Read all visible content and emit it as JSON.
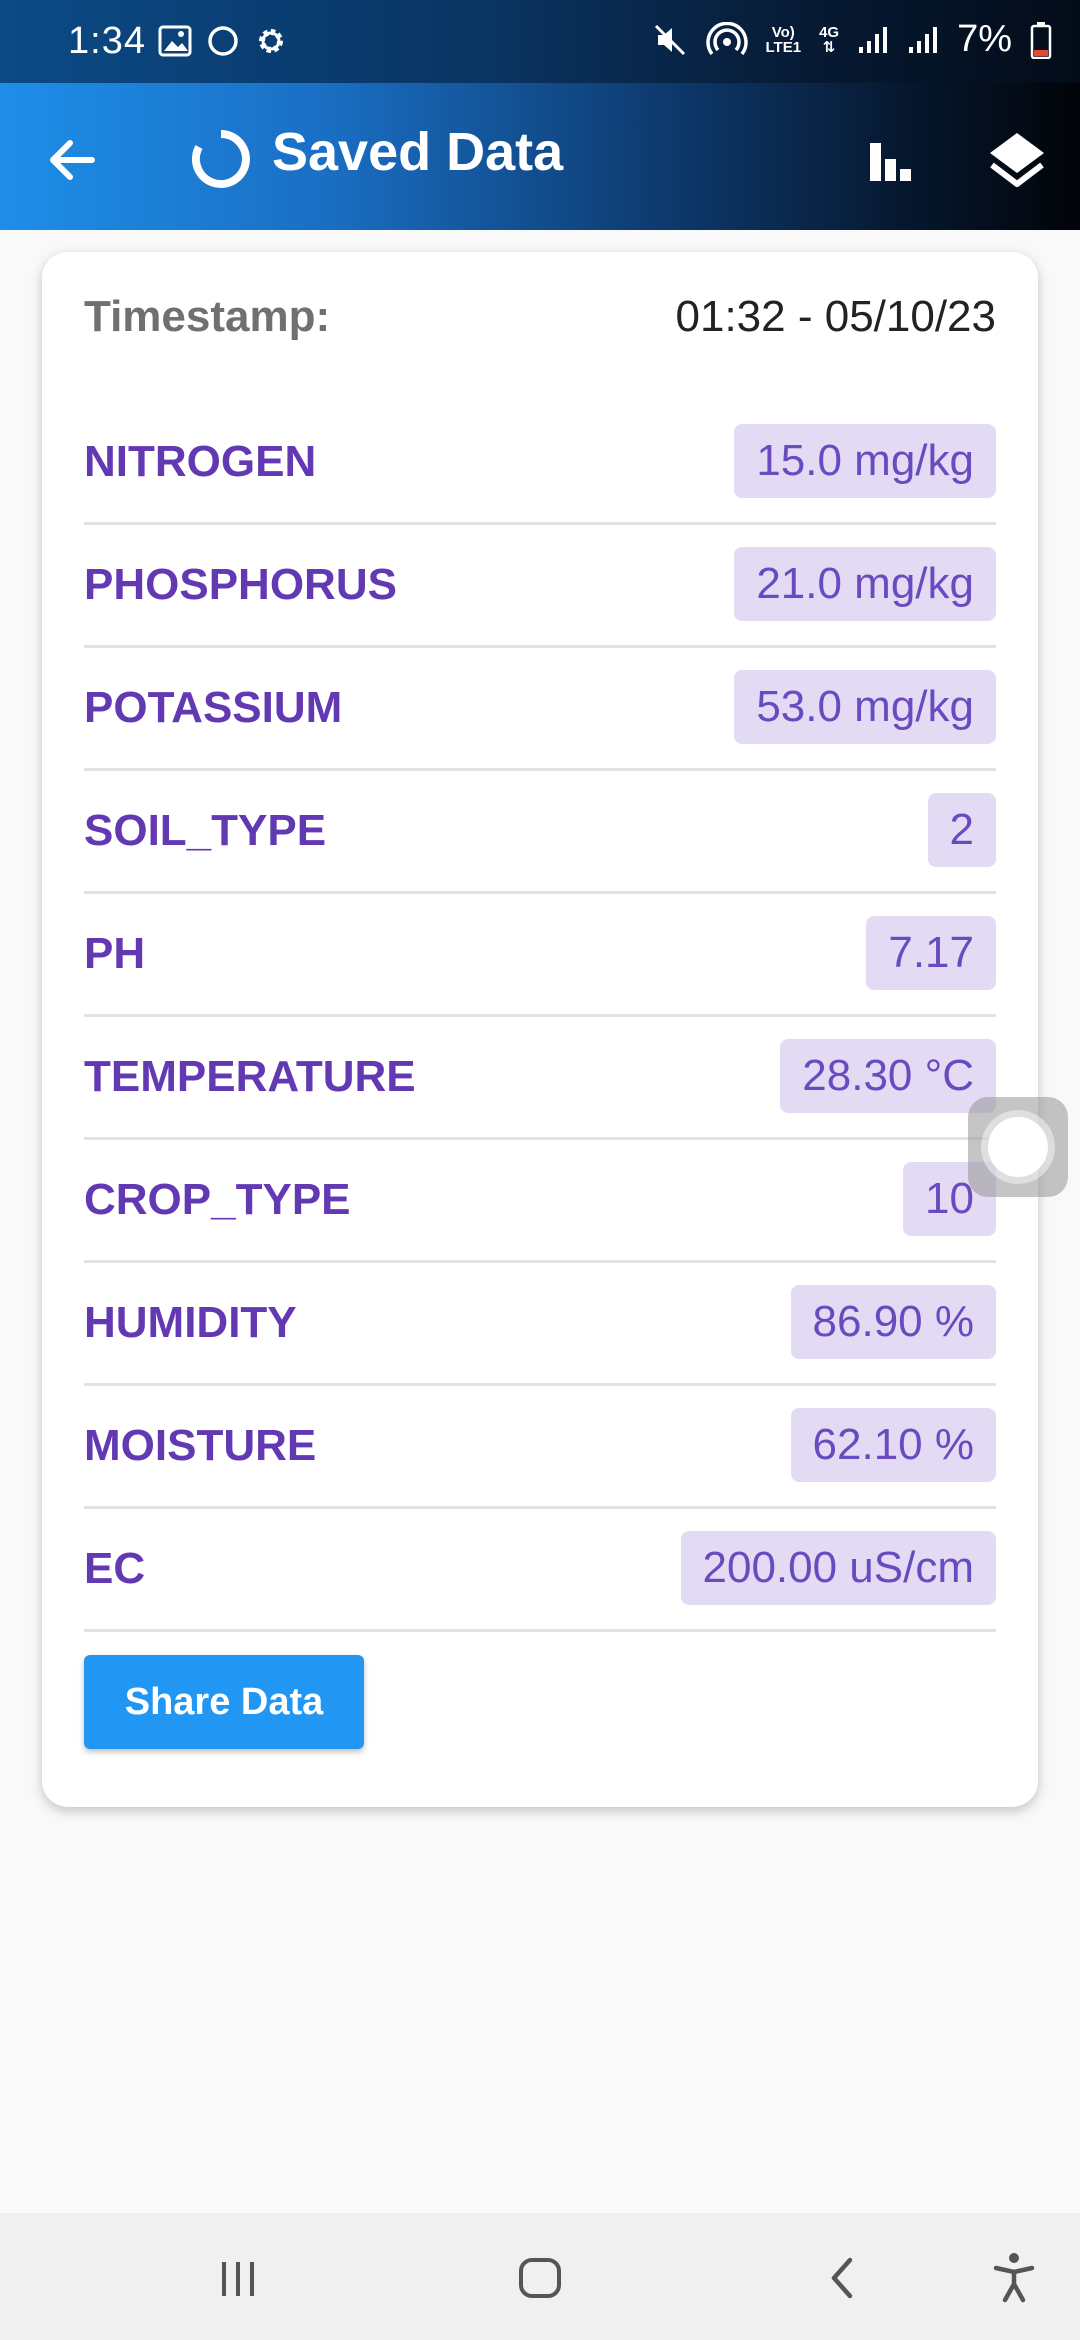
{
  "status_bar": {
    "time": "1:34",
    "battery": "7%",
    "network_top": "Vo)",
    "network_bottom": "LTE1",
    "network_gen": "4G",
    "icons": [
      "gallery-icon",
      "circle-icon",
      "gear-icon",
      "mute-icon",
      "hotspot-icon",
      "signal-icon",
      "signal-icon",
      "battery-icon"
    ]
  },
  "app_bar": {
    "title": "Saved Data",
    "back_icon": "arrow-left-icon",
    "title_icon": "loading-circle-icon",
    "actions": [
      "bar-chart-icon",
      "layers-icon"
    ]
  },
  "card": {
    "timestamp_label": "Timestamp:",
    "timestamp_value": "01:32 - 05/10/23",
    "rows": [
      {
        "label": "NITROGEN",
        "value": "15.0 mg/kg"
      },
      {
        "label": "PHOSPHORUS",
        "value": "21.0 mg/kg"
      },
      {
        "label": "POTASSIUM",
        "value": "53.0 mg/kg"
      },
      {
        "label": "SOIL_TYPE",
        "value": "2"
      },
      {
        "label": "PH",
        "value": "7.17"
      },
      {
        "label": "TEMPERATURE",
        "value": "28.30 °C"
      },
      {
        "label": "CROP_TYPE",
        "value": "10"
      },
      {
        "label": "HUMIDITY",
        "value": "86.90 %"
      },
      {
        "label": "MOISTURE",
        "value": "62.10 %"
      },
      {
        "label": "EC",
        "value": "200.00 uS/cm"
      }
    ],
    "share_button": "Share Data"
  },
  "colors": {
    "label": "#6339b3",
    "value_bg": "#e3dbf3",
    "button": "#2196f3"
  },
  "nav_bar": [
    "recent-apps-icon",
    "home-icon",
    "back-icon",
    "accessibility-icon"
  ]
}
